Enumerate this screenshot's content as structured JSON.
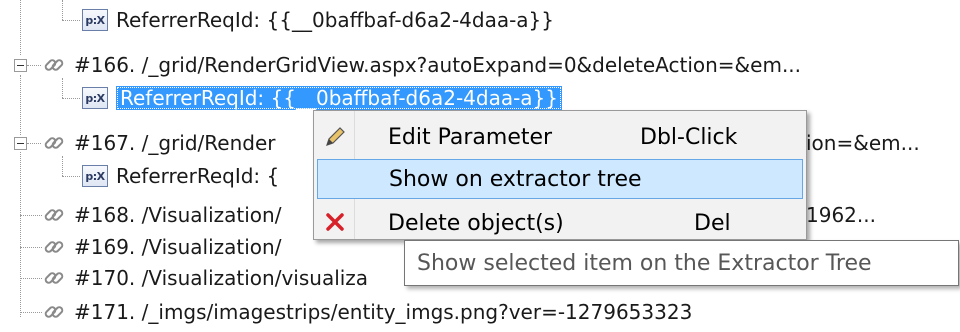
{
  "tree": {
    "rows": [
      {
        "text": "ReferrerReqId: {{__0baffbaf-d6a2-4daa-a}}",
        "icon": "parameter-icon",
        "icon_text": "p:X"
      },
      {
        "text": "#166. /_grid/RenderGridView.aspx?autoExpand=0&deleteAction=&em...",
        "icon": "link-icon"
      },
      {
        "text": "ReferrerReqId: {{__0baffbaf-d6a2-4daa-a}}",
        "icon": "parameter-icon",
        "icon_text": "p:X",
        "selected": true
      },
      {
        "text": "#167. /_grid/Render",
        "tail": "ion=&em...",
        "icon": "link-icon"
      },
      {
        "text": "ReferrerReqId: {",
        "icon": "parameter-icon",
        "icon_text": "p:X"
      },
      {
        "text": "#168. /Visualization/",
        "tail": "1962...",
        "icon": "link-icon"
      },
      {
        "text": "#169. /Visualization/",
        "icon": "link-icon"
      },
      {
        "text": "#170. /Visualization/visualiza",
        "icon": "link-icon"
      },
      {
        "text": "#171. /_imgs/imagestrips/entity_imgs.png?ver=-1279653323",
        "icon": "link-icon"
      }
    ]
  },
  "context_menu": {
    "items": [
      {
        "label": "Edit Parameter",
        "shortcut": "Dbl-Click",
        "icon": "pencil-icon"
      },
      {
        "label": "Show on extractor tree",
        "shortcut": "",
        "icon": "",
        "highlighted": true
      },
      {
        "label": "Delete object(s)",
        "shortcut": "Del",
        "icon": "red-x-icon"
      }
    ]
  },
  "tooltip": {
    "text": "Show selected item on the Extractor Tree"
  }
}
